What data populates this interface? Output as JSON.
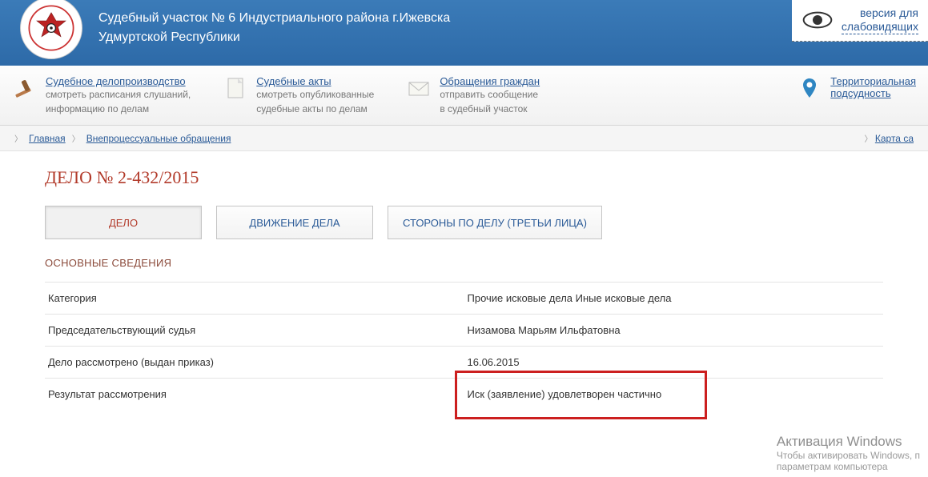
{
  "header": {
    "line1": "Судебный участок № 6 Индустриального района г.Ижевска",
    "line2": "Удмуртской Республики"
  },
  "accessibility": {
    "line1": "версия для",
    "line2": "слабовидящих"
  },
  "menu": [
    {
      "title": "Судебное делопроизводство",
      "sub1": "смотреть расписания слушаний,",
      "sub2": "информацию по делам"
    },
    {
      "title": "Судебные акты",
      "sub1": "смотреть опубликованные",
      "sub2": "судебные акты по делам"
    },
    {
      "title": "Обращения граждан",
      "sub1": "отправить сообщение",
      "sub2": "в судебный участок"
    },
    {
      "title": "Территориальная",
      "sub1": "подсудность",
      "sub2": ""
    }
  ],
  "breadcrumb": {
    "home": "Главная",
    "item": "Внепроцессуальные обращения",
    "right": "Карта са"
  },
  "case": {
    "title": "ДЕЛО № 2-432/2015"
  },
  "tabs": {
    "t1": "ДЕЛО",
    "t2": "ДВИЖЕНИЕ ДЕЛА",
    "t3": "СТОРОНЫ ПО ДЕЛУ (ТРЕТЬИ ЛИЦА)"
  },
  "section": "ОСНОВНЫЕ СВЕДЕНИЯ",
  "rows": [
    {
      "label": "Категория",
      "value": "Прочие исковые дела Иные исковые дела"
    },
    {
      "label": "Председательствующий судья",
      "value": "Низамова Марьям Ильфатовна"
    },
    {
      "label": "Дело рассмотрено (выдан приказ)",
      "value": "16.06.2015"
    },
    {
      "label": "Результат рассмотрения",
      "value": "Иск (заявление) удовлетворен частично"
    }
  ],
  "watermark": {
    "l1": "Активация Windows",
    "l2": "Чтобы активировать Windows, п",
    "l3": "параметрам компьютера"
  }
}
